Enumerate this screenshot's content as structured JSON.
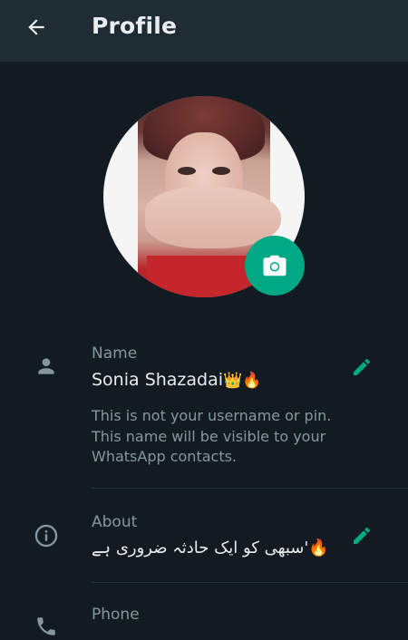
{
  "header": {
    "title": "Profile",
    "back_icon": "arrow-left-icon"
  },
  "avatar": {
    "camera_icon": "camera-icon",
    "accent_color": "#00a884"
  },
  "name_row": {
    "icon": "person-icon",
    "label": "Name",
    "value": "Sonia Shazadai",
    "emojis": "👑🔥",
    "hint": "This is not your username or pin. This name will be visible to your WhatsApp contacts.",
    "edit_icon": "pencil-icon"
  },
  "about_row": {
    "icon": "info-icon",
    "label": "About",
    "value": "سبھی کو ایک حادثہ ضروری ہے'🔥",
    "edit_icon": "pencil-icon"
  },
  "phone_row": {
    "icon": "phone-icon",
    "label": "Phone"
  }
}
